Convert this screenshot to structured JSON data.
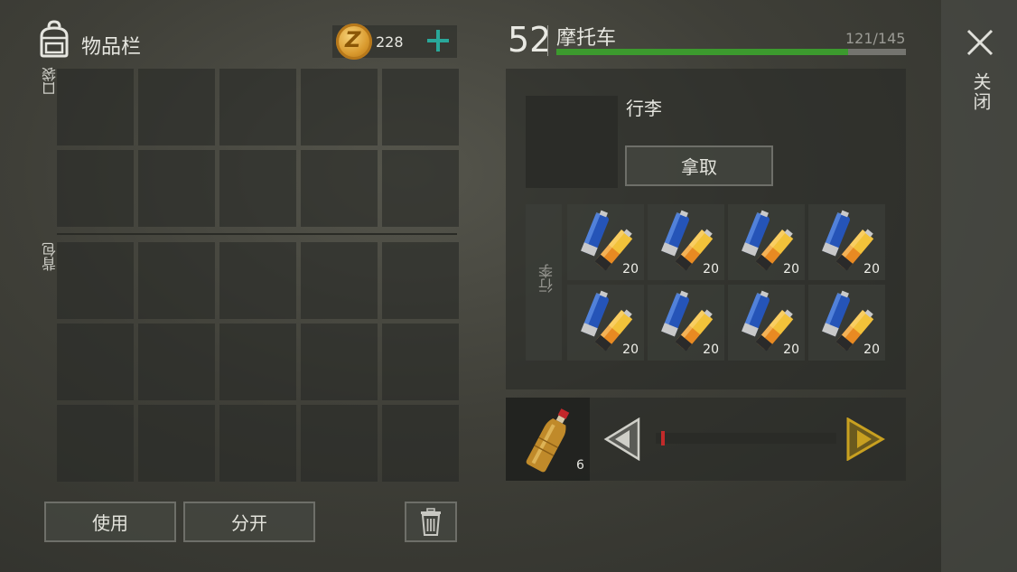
{
  "inventory": {
    "title": "物品栏",
    "currency_icon": "coin-icon",
    "coins": "228",
    "add_icon": "plus-icon",
    "pocket_label": "口袋",
    "backpack_label": "背包",
    "pocket_slots": 10,
    "backpack_slots": 15,
    "use_button": "使用",
    "split_button": "分开",
    "trash_icon": "trash-icon"
  },
  "vehicle": {
    "level": "52",
    "name": "摩托车",
    "capacity": "121/145",
    "durability_fraction": 0.835
  },
  "container": {
    "name": "行李",
    "take_button": "拿取",
    "side_label": "行李",
    "items": [
      {
        "icon": "battery-icon",
        "count": "20"
      },
      {
        "icon": "battery-icon",
        "count": "20"
      },
      {
        "icon": "battery-icon",
        "count": "20"
      },
      {
        "icon": "battery-icon",
        "count": "20"
      },
      {
        "icon": "battery-icon",
        "count": "20"
      },
      {
        "icon": "battery-icon",
        "count": "20"
      },
      {
        "icon": "battery-icon",
        "count": "20"
      },
      {
        "icon": "battery-icon",
        "count": "20"
      }
    ]
  },
  "transfer": {
    "item_icon": "bottle-icon",
    "count": "6",
    "slider_value": 0.03
  },
  "sidebar": {
    "close_label": "关闭",
    "close_icon": "close-icon"
  },
  "colors": {
    "progress_green": "#3c9a2e",
    "accent_teal": "#29a89a",
    "arrow_gold": "#c8a020",
    "slider_red": "#c12a2a"
  }
}
